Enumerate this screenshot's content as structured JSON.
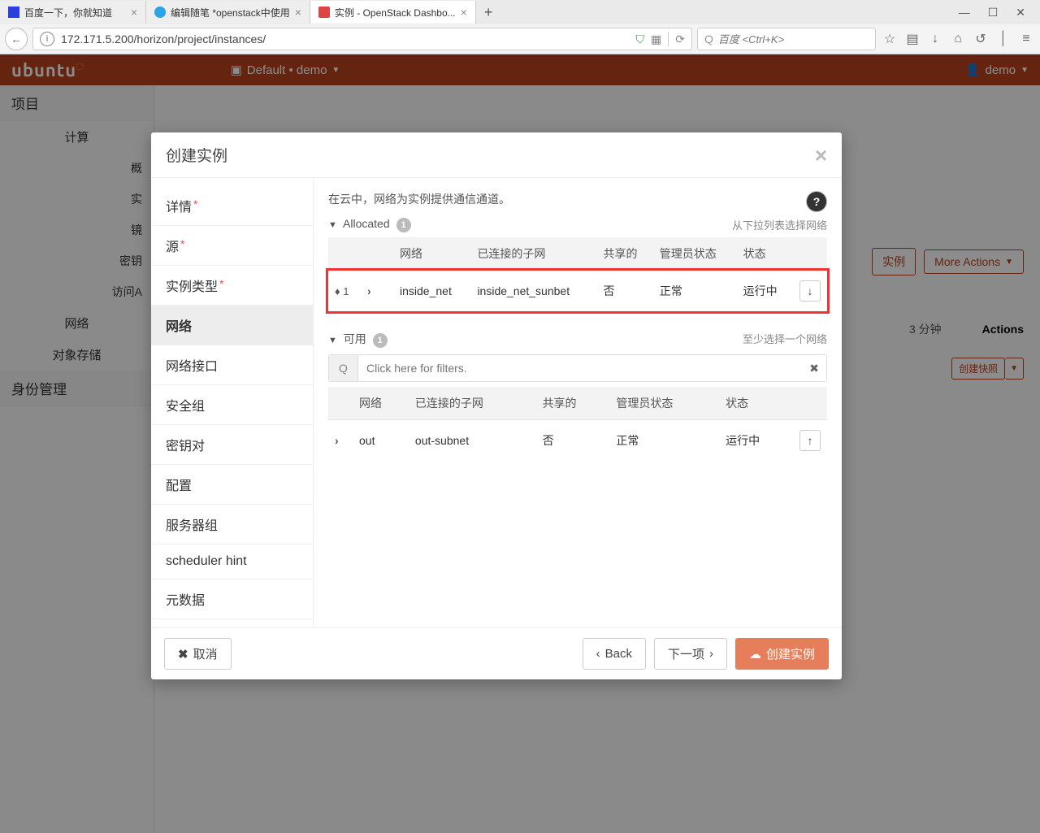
{
  "browser": {
    "tabs": [
      {
        "title": "百度一下，你就知道"
      },
      {
        "title": "编辑随笔 *openstack中使用"
      },
      {
        "title": "实例 - OpenStack Dashbo..."
      }
    ],
    "url": "172.171.5.200/horizon/project/instances/",
    "search_placeholder": "百度 <Ctrl+K>"
  },
  "topbar": {
    "logo": "ubuntu",
    "project": "Default • demo",
    "user": "demo"
  },
  "sidebar": {
    "project": "项目",
    "compute": "计算",
    "items": [
      "概",
      "实",
      "镜",
      "密钥",
      "访问A"
    ],
    "network": "网络",
    "object": "对象存储",
    "identity": "身份管理"
  },
  "main": {
    "instance_label": "实例",
    "more_actions": "More Actions",
    "time_col": "分钟",
    "actions_col": "Actions",
    "snapshot": "创建快照"
  },
  "modal": {
    "title": "创建实例",
    "steps": [
      "详情",
      "源",
      "实例类型",
      "网络",
      "网络接口",
      "安全组",
      "密钥对",
      "配置",
      "服务器组",
      "scheduler hint",
      "元数据"
    ],
    "required_steps": [
      0,
      1,
      2
    ],
    "active_step": 3,
    "description": "在云中，网络为实例提供通信通道。",
    "select_hint": "从下拉列表选择网络",
    "allocated_label": "Allocated",
    "allocated_count": "1",
    "available_label": "可用",
    "available_count": "1",
    "available_hint": "至少选择一个网络",
    "filter_placeholder": "Click here for filters.",
    "headers": {
      "network": "网络",
      "subnets": "已连接的子网",
      "shared": "共享的",
      "admin": "管理员状态",
      "status": "状态"
    },
    "allocated_rows": [
      {
        "order": "1",
        "network": "inside_net",
        "subnet": "inside_net_sunbet",
        "shared": "否",
        "admin": "正常",
        "status": "运行中"
      }
    ],
    "available_rows": [
      {
        "network": "out",
        "subnet": "out-subnet",
        "shared": "否",
        "admin": "正常",
        "status": "运行中"
      }
    ],
    "footer": {
      "cancel": "取消",
      "back": "Back",
      "next": "下一项",
      "launch": "创建实例"
    }
  }
}
